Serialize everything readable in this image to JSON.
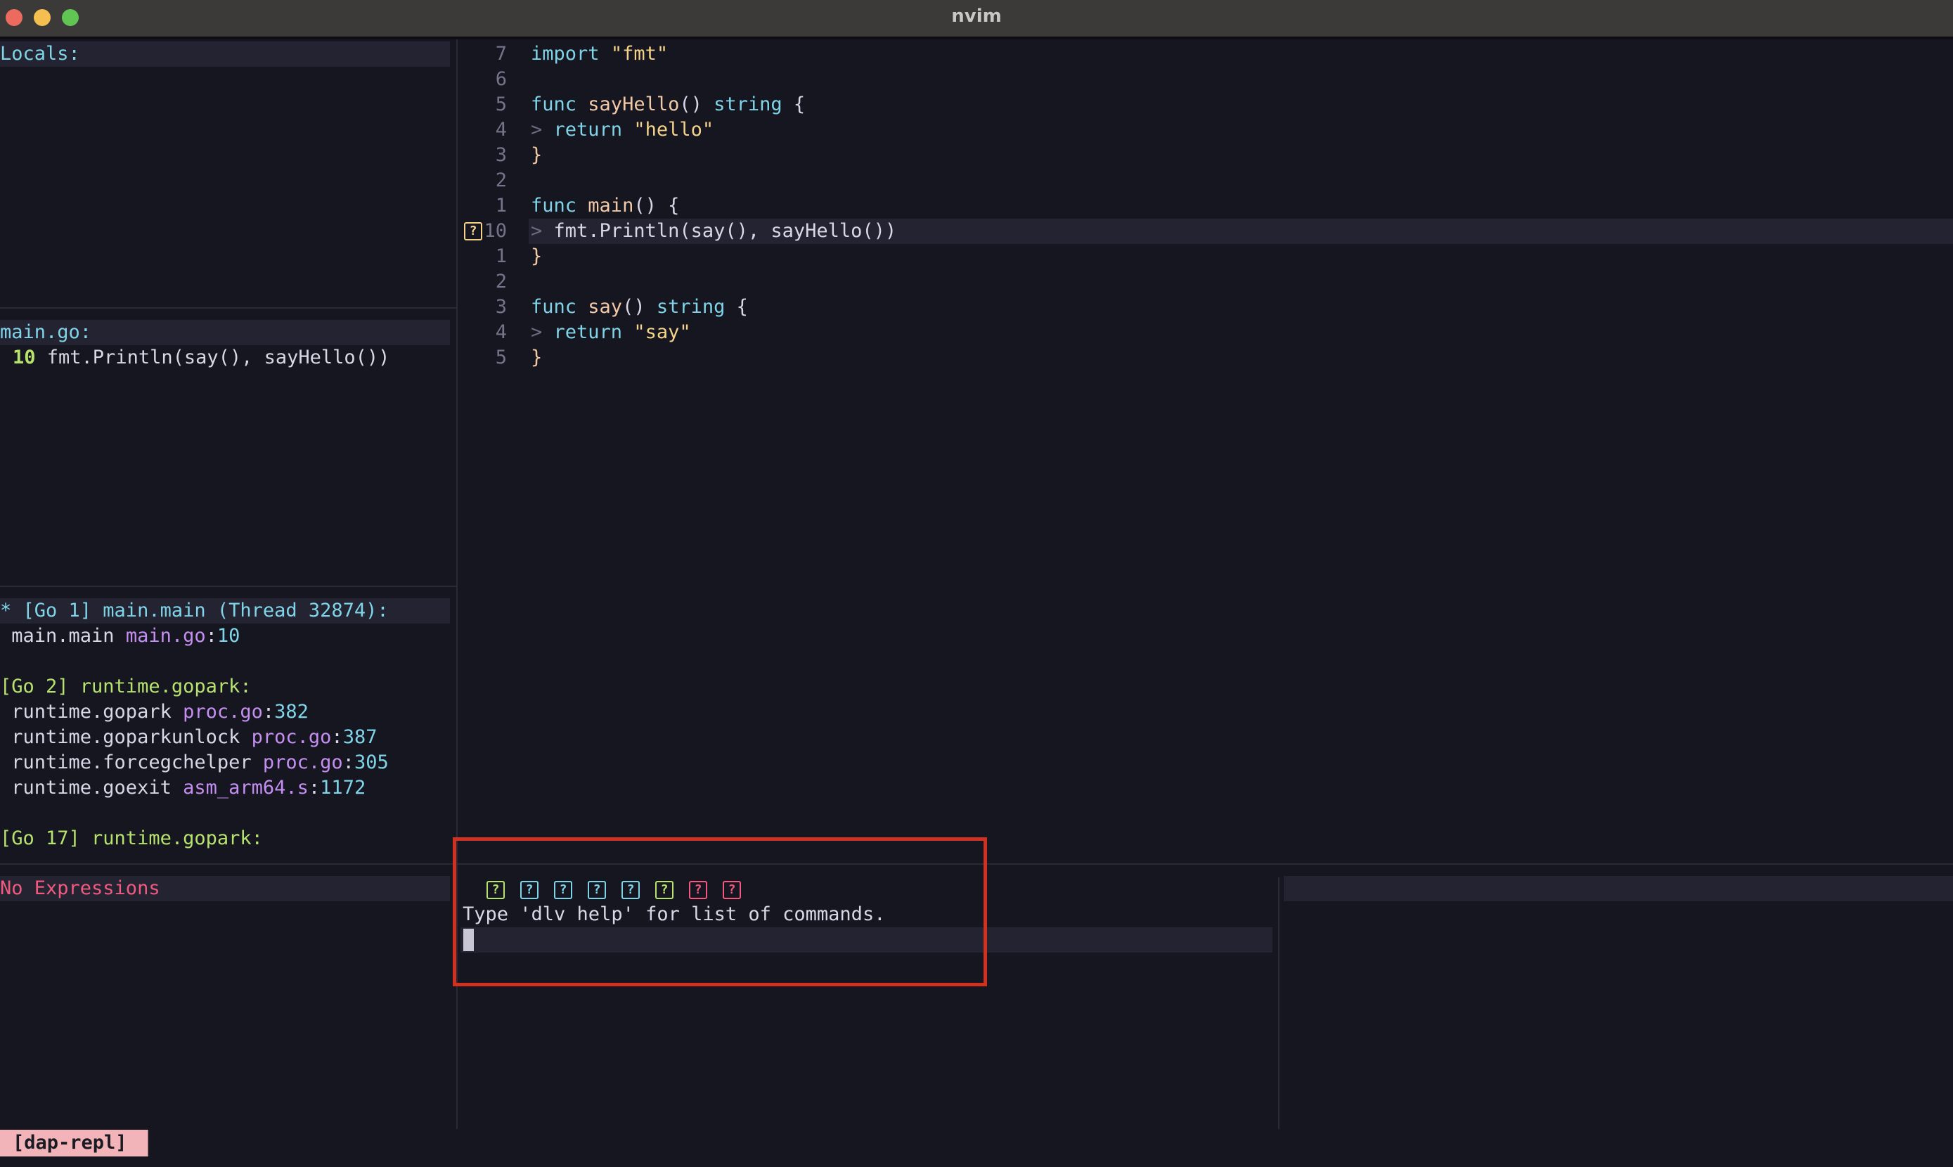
{
  "window": {
    "title": "nvim"
  },
  "scopes": {
    "header": "Locals:"
  },
  "breakpoints": {
    "file": "main.go:",
    "line_number": "10",
    "line_text": "fmt.Println(say(), sayHello())"
  },
  "threads": {
    "items": [
      {
        "text": "* [Go 1] main.main (Thread 32874):",
        "color": "cyan"
      },
      {
        "text": " main.main ",
        "file": "main.go",
        "sep": ":",
        "line": "10"
      },
      {
        "text": ""
      },
      {
        "text": "[Go 2] runtime.gopark:",
        "color": "green"
      },
      {
        "text": " runtime.gopark ",
        "file": "proc.go",
        "sep": ":",
        "line": "382"
      },
      {
        "text": " runtime.goparkunlock ",
        "file": "proc.go",
        "sep": ":",
        "line": "387"
      },
      {
        "text": " runtime.forcegchelper ",
        "file": "proc.go",
        "sep": ":",
        "line": "305"
      },
      {
        "text": " runtime.goexit ",
        "file": "asm_arm64.s",
        "sep": ":",
        "line": "1172"
      },
      {
        "text": ""
      },
      {
        "text": "[Go 17] runtime.gopark:",
        "color": "green"
      }
    ]
  },
  "watches": {
    "empty_text": "No Expressions"
  },
  "editor": {
    "lines": [
      {
        "num": "7",
        "tokens": [
          [
            "kw",
            "import"
          ],
          [
            "plain",
            " "
          ],
          [
            "str",
            "\"fmt\""
          ]
        ]
      },
      {
        "num": "6",
        "tokens": []
      },
      {
        "num": "5",
        "tokens": [
          [
            "kw",
            "func"
          ],
          [
            "plain",
            " "
          ],
          [
            "fn",
            "sayHello"
          ],
          [
            "plain",
            "() "
          ],
          [
            "kw",
            "string"
          ],
          [
            "plain",
            " {"
          ]
        ]
      },
      {
        "num": "4",
        "tokens": [
          [
            "dim",
            "> "
          ],
          [
            "kw",
            "return"
          ],
          [
            "plain",
            " "
          ],
          [
            "str",
            "\"hello\""
          ]
        ]
      },
      {
        "num": "3",
        "tokens": [
          [
            "fn",
            "}"
          ]
        ]
      },
      {
        "num": "2",
        "tokens": []
      },
      {
        "num": "1",
        "tokens": [
          [
            "kw",
            "func"
          ],
          [
            "plain",
            " "
          ],
          [
            "fn",
            "main"
          ],
          [
            "plain",
            "() {"
          ]
        ]
      },
      {
        "num": "10",
        "current": true,
        "tokens": [
          [
            "dim",
            "> "
          ],
          [
            "plain",
            "fmt.Println(say(), sayHello())"
          ]
        ]
      },
      {
        "num": "1",
        "tokens": [
          [
            "fn",
            "}"
          ]
        ]
      },
      {
        "num": "2",
        "tokens": []
      },
      {
        "num": "3",
        "tokens": [
          [
            "kw",
            "func"
          ],
          [
            "plain",
            " "
          ],
          [
            "fn",
            "say"
          ],
          [
            "plain",
            "() "
          ],
          [
            "kw",
            "string"
          ],
          [
            "plain",
            " {"
          ]
        ]
      },
      {
        "num": "4",
        "tokens": [
          [
            "dim",
            "> "
          ],
          [
            "kw",
            "return"
          ],
          [
            "plain",
            " "
          ],
          [
            "str",
            "\"say\""
          ]
        ]
      },
      {
        "num": "5",
        "tokens": [
          [
            "fn",
            "}"
          ]
        ]
      }
    ],
    "stopped_sign": "?"
  },
  "repl": {
    "controls": [
      "?",
      "?",
      "?",
      "?",
      "?",
      "?",
      "?",
      "?"
    ],
    "control_colors": [
      "g",
      "c",
      "c",
      "c",
      "c",
      "g",
      "p",
      "p"
    ],
    "message": "Type 'dlv help' for list of commands."
  },
  "statusline": {
    "buffer_name": "[dap-repl]"
  }
}
